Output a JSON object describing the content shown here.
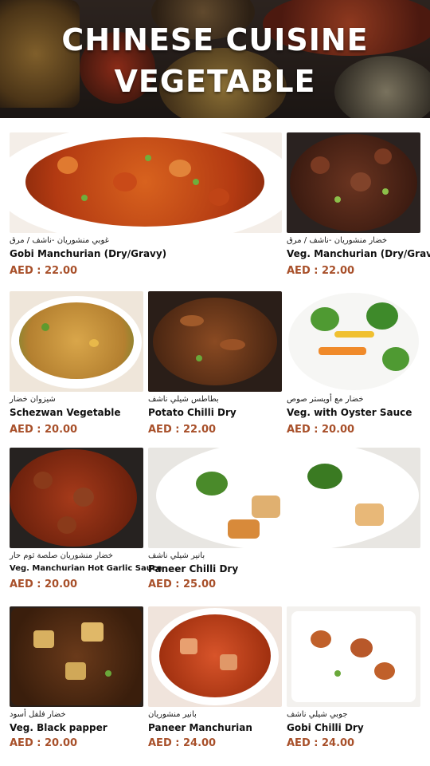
{
  "header": {
    "line1": "CHINESE CUISINE",
    "line2": "VEGETABLE"
  },
  "colors": {
    "price": "#a8502a",
    "text": "#111111"
  },
  "items": [
    {
      "arabic": "غوبي منشوريان -ناشف / مرق",
      "name": "Gobi Manchurian (Dry/Gravy)",
      "price": "AED : 22.00"
    },
    {
      "arabic": "خضار منشوريان -ناشف / مرق",
      "name": "Veg. Manchurian (Dry/Gravy)",
      "price": "AED : 22.00"
    },
    {
      "arabic": "شيزوان خضار",
      "name": "Schezwan Vegetable",
      "price": "AED : 20.00"
    },
    {
      "arabic": "بطاطس شيلي ناشف",
      "name": "Potato Chilli Dry",
      "price": "AED : 22.00"
    },
    {
      "arabic": "خضار مع أويستر صوص",
      "name": "Veg. with Oyster Sauce",
      "price": "AED : 20.00"
    },
    {
      "arabic": "خضار منشوريان صلصة ثوم حار",
      "name": "Veg. Manchurian Hot Garlic Sauce",
      "price": "AED : 20.00"
    },
    {
      "arabic": "بانير شيلي ناشف",
      "name": "Paneer Chilli Dry",
      "price": "AED : 25.00"
    },
    {
      "arabic": "خضار فلفل أسود",
      "name": "Veg. Black papper",
      "price": "AED : 20.00"
    },
    {
      "arabic": "بانير منشوريان",
      "name": "Paneer Manchurian",
      "price": "AED : 24.00"
    },
    {
      "arabic": "جوبي شيلي ناشف",
      "name": "Gobi Chilli Dry",
      "price": "AED : 24.00"
    }
  ]
}
